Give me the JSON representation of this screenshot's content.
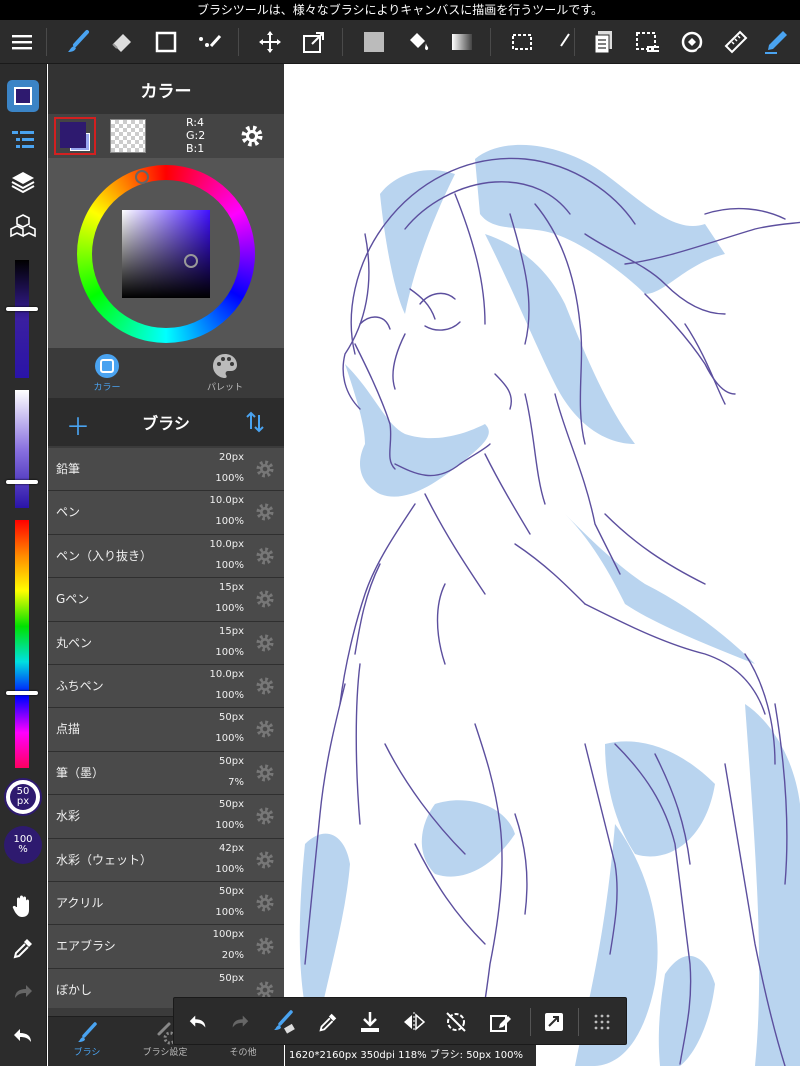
{
  "hint_text": "ブラシツールは、様々なブラシによりキャンバスに描画を行うツールです。",
  "toolbar": {
    "menu_icon": "menu-icon",
    "tools": [
      "brush-icon",
      "eraser-icon",
      "rectangle-icon",
      "dot-brush-icon",
      "move-icon",
      "transform-icon",
      "fill-color-icon",
      "bucket-icon",
      "gradient-icon",
      "select-icon",
      "lasso-icon",
      "copy-icon",
      "select-layer-icon",
      "rotate-icon",
      "ruler-icon",
      "pen-icon"
    ]
  },
  "left_sidebar": {
    "brush_size": {
      "value": "50",
      "unit": "px"
    },
    "opacity": {
      "value": "100",
      "unit": "%"
    }
  },
  "color_panel": {
    "title": "カラー",
    "rgb": {
      "r": "R:4",
      "g": "G:2",
      "b": "B:1"
    },
    "tabs": [
      {
        "label": "カラー",
        "active": true
      },
      {
        "label": "パレット",
        "active": false
      }
    ],
    "main_color": "#2e1a6f"
  },
  "brush_panel": {
    "title": "ブラシ",
    "items": [
      {
        "name": "鉛筆",
        "size": "20px",
        "opacity": "100%"
      },
      {
        "name": "ペン",
        "size": "10.0px",
        "opacity": "100%"
      },
      {
        "name": "ペン（入り抜き）",
        "size": "10.0px",
        "opacity": "100%"
      },
      {
        "name": "Gペン",
        "size": "15px",
        "opacity": "100%"
      },
      {
        "name": "丸ペン",
        "size": "15px",
        "opacity": "100%"
      },
      {
        "name": "ふちペン",
        "size": "10.0px",
        "opacity": "100%"
      },
      {
        "name": "点描",
        "size": "50px",
        "opacity": "100%"
      },
      {
        "name": "筆（墨）",
        "size": "50px",
        "opacity": "7%"
      },
      {
        "name": "水彩",
        "size": "50px",
        "opacity": "100%"
      },
      {
        "name": "水彩（ウェット）",
        "size": "42px",
        "opacity": "100%"
      },
      {
        "name": "アクリル",
        "size": "50px",
        "opacity": "100%"
      },
      {
        "name": "エアブラシ",
        "size": "100px",
        "opacity": "20%"
      },
      {
        "name": "ぼかし",
        "size": "50px",
        "opacity": ""
      }
    ]
  },
  "bottom_tabs": [
    {
      "label": "ブラシ",
      "active": true
    },
    {
      "label": "ブラシ設定",
      "active": false
    },
    {
      "label": "その他",
      "active": false
    }
  ],
  "status": "1620*2160px 350dpi 118% ブラシ: 50px 100%"
}
